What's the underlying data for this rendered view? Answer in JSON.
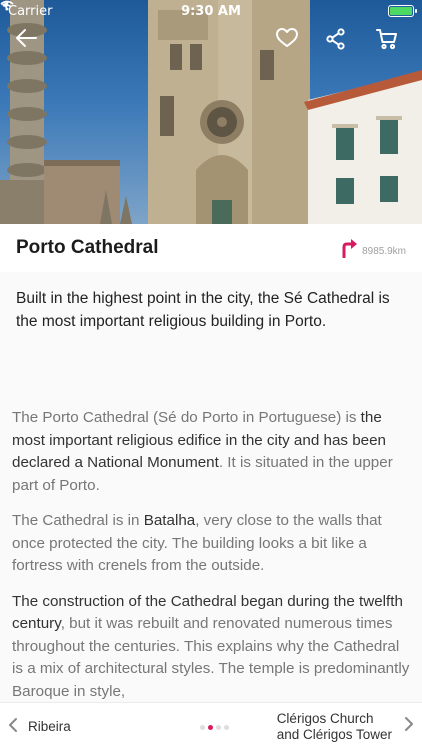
{
  "status_bar": {
    "carrier": "Carrier",
    "time": "9:30 AM"
  },
  "hero": {
    "icons": [
      "back-arrow-icon",
      "heart-icon",
      "share-icon",
      "cart-icon"
    ],
    "colors": {
      "sky": "#2a68a8",
      "stone": "#b8aa90",
      "building": "#f2f0ea"
    }
  },
  "place": {
    "title": "Porto Cathedral",
    "distance": "8985.9km",
    "distance_icon": "directions-arrow-icon",
    "accent_color": "#d81b60"
  },
  "intro": "Built in the highest point in the city, the Sé Cathedral is the most important religious building in Porto.",
  "article": {
    "p1": {
      "a": "The Porto Cathedral (Sé do Porto in Portuguese) is ",
      "b": "the most important religious edifice in the city and has been declared a National Monument",
      "c": ". It is situated in the upper part of Porto."
    },
    "p2": {
      "a": "The Cathedral is in ",
      "b": "Batalha",
      "c": ", very close to the walls that once protected the city. The building looks a bit like a fortress with crenels from the outside."
    },
    "p3": {
      "a": "The construction of the Cathedral began during the twelfth century",
      "b": ", but it was rebuilt and renovated numerous times throughout the centuries. This explains why the Cathedral is a mix of architectural styles. The temple is predominantly Baroque in style,"
    }
  },
  "bottom_nav": {
    "prev_label": "Ribeira",
    "next_label_line1": "Clérigos Church",
    "next_label_line2": "and Clérigos Tower",
    "page_dots": 4,
    "active_dot": 1
  }
}
